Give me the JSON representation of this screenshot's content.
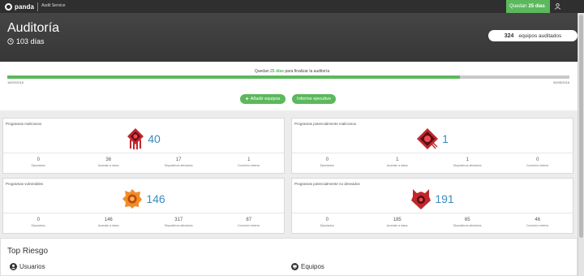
{
  "topbar": {
    "brand_name": "panda",
    "brand_product": "Audit Service",
    "days_left_prefix": "Quedan",
    "days_left_value": "25 días",
    "user_icon": "user-icon"
  },
  "header": {
    "title": "Auditoría",
    "days_elapsed": "103 días",
    "devices_count": "324",
    "devices_label": "equipos auditados"
  },
  "progress": {
    "text_prefix": "Quedan",
    "text_days": "25 días",
    "text_suffix": "para finalizar la auditoría",
    "percent": 80.5,
    "start_date": "16/02/2016",
    "end_date": "30/05/2016",
    "add_devices_label": "Añadir equipos",
    "report_label": "Informe ejecutivo"
  },
  "cards": [
    {
      "title": "Programas maliciosos",
      "count": "40",
      "icon": "malware-icon",
      "stats": [
        {
          "value": "0",
          "label": "Ejecutados"
        },
        {
          "value": "36",
          "label": "Accedan a datos"
        },
        {
          "value": "17",
          "label": "Dispositivos afectados"
        },
        {
          "value": "1",
          "label": "Conexión exterior"
        }
      ]
    },
    {
      "title": "Programas potencialmente maliciosos",
      "count": "1",
      "icon": "pup-malicious-icon",
      "stats": [
        {
          "value": "0",
          "label": "Ejecutados"
        },
        {
          "value": "1",
          "label": "Accedan a datos"
        },
        {
          "value": "1",
          "label": "Dispositivos afectados"
        },
        {
          "value": "0",
          "label": "Conexión exterior"
        }
      ]
    },
    {
      "title": "Programas vulnerables",
      "count": "146",
      "icon": "vulnerable-icon",
      "stats": [
        {
          "value": "0",
          "label": "Ejecutados"
        },
        {
          "value": "146",
          "label": "Accedan a datos"
        },
        {
          "value": "317",
          "label": "Dispositivos afectados"
        },
        {
          "value": "87",
          "label": "Conexión exterior"
        }
      ]
    },
    {
      "title": "Programas potencialmente no deseados",
      "count": "191",
      "icon": "pup-unwanted-icon",
      "stats": [
        {
          "value": "0",
          "label": "Ejecutados"
        },
        {
          "value": "185",
          "label": "Accedan a datos"
        },
        {
          "value": "65",
          "label": "Dispositivos afectados"
        },
        {
          "value": "46",
          "label": "Conexión exterior"
        }
      ]
    }
  ],
  "top_risk": {
    "title": "Top Riesgo",
    "users_label": "Usuarios",
    "devices_label": "Equipos"
  },
  "colors": {
    "accent_green": "#5cb85c",
    "count_blue": "#3a8bbf",
    "malware_red": "#c0272d",
    "vulnerable_orange": "#f28c28"
  }
}
